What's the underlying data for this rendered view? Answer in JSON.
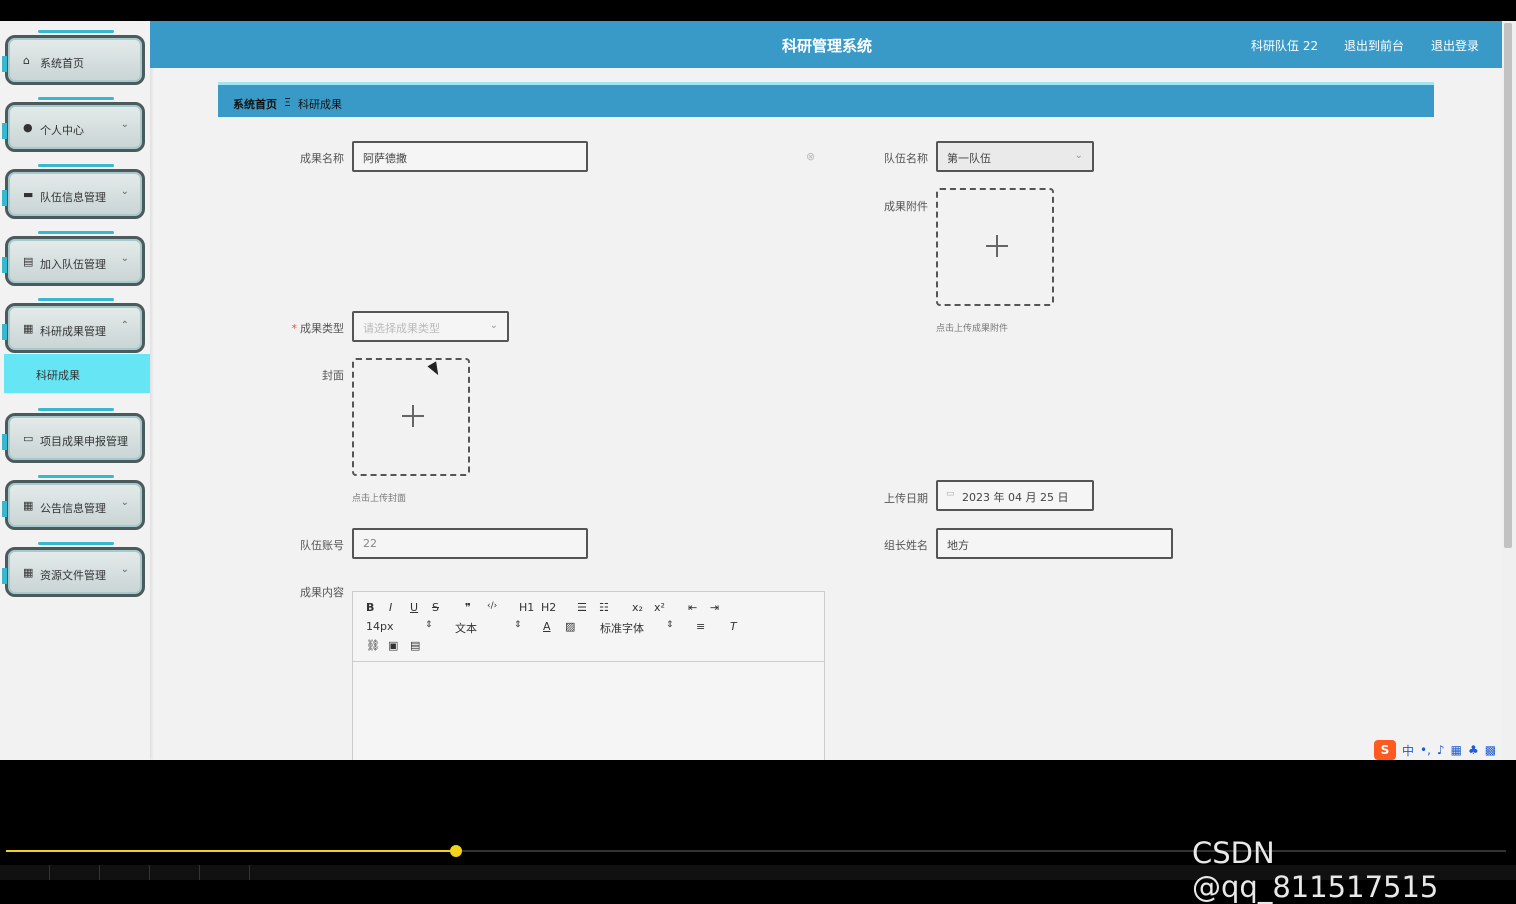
{
  "header": {
    "title": "科研管理系统",
    "team_link": "科研队伍 22",
    "front_link": "退出到前台",
    "logout_link": "退出登录"
  },
  "sidebar": {
    "items": [
      {
        "label": "系统首页",
        "icon": "home-icon",
        "glyph": "⌂"
      },
      {
        "label": "个人中心",
        "icon": "user-icon",
        "glyph": "●"
      },
      {
        "label": "队伍信息管理",
        "icon": "monitor-icon",
        "glyph": "▬"
      },
      {
        "label": "加入队伍管理",
        "icon": "clipboard-icon",
        "glyph": "▤"
      },
      {
        "label": "科研成果管理",
        "icon": "grid-icon",
        "glyph": "▦"
      },
      {
        "label": "项目成果申报管理",
        "icon": "briefcase-icon",
        "glyph": "▭"
      },
      {
        "label": "公告信息管理",
        "icon": "grid-icon",
        "glyph": "▦"
      },
      {
        "label": "资源文件管理",
        "icon": "grid-icon",
        "glyph": "▦"
      }
    ],
    "submenu_active": "科研成果"
  },
  "breadcrumb": {
    "home": "系统首页",
    "separator": "Ξ",
    "current": "科研成果"
  },
  "form": {
    "name_label": "成果名称",
    "name_value": "阿萨德撒",
    "team_label": "队伍名称",
    "team_value": "第一队伍",
    "attachment_label": "成果附件",
    "attachment_hint": "点击上传成果附件",
    "type_label": "成果类型",
    "type_required": "*",
    "type_placeholder": "请选择成果类型",
    "cover_label": "封面",
    "cover_hint": "点击上传封面",
    "date_label": "上传日期",
    "date_value": "2023 年 04 月 25 日",
    "account_label": "队伍账号",
    "account_value": "22",
    "leader_label": "组长姓名",
    "leader_value": "地方",
    "content_label": "成果内容"
  },
  "editor": {
    "font_size": "14px",
    "text_style": "文本",
    "font_family": "标准字体",
    "buttons": [
      "B",
      "I",
      "U",
      "S",
      "❞",
      "‹/›",
      "H1",
      "H2",
      "☰",
      "☷",
      "x₂",
      "x²",
      "⇤",
      "⇥"
    ]
  },
  "ime": {
    "logo": "S",
    "mode": "中"
  },
  "player": {
    "progress_fraction": 0.3,
    "watermark": "CSDN @qq_811517515"
  }
}
